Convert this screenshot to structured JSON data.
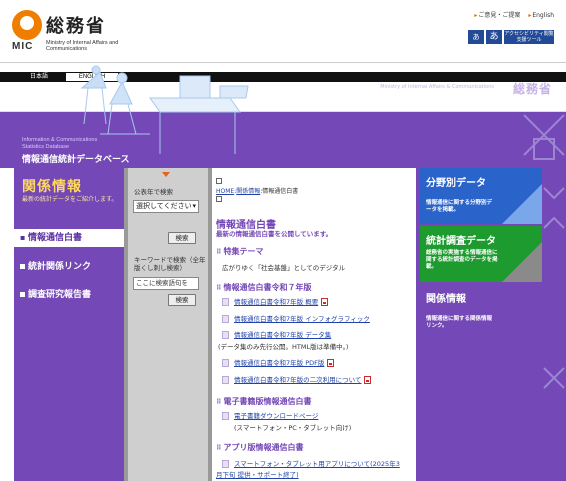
{
  "header": {
    "logo_ja": "総務省",
    "logo_mic": "MIC",
    "logo_en": "Ministry of Internal Affairs and Communications",
    "links": [
      "ご意見・ご提案",
      "English"
    ],
    "accessibility": {
      "font_small": "あ",
      "font_large": "あ",
      "tool_label": "アクセシビリティ閲覧支援ツール"
    }
  },
  "languages": [
    "日本語",
    "ENGLISH"
  ],
  "banner": {
    "en": "Ministry of Internal Affairs & Communications",
    "ja": "総務省",
    "db_en": "Information & Communications Statistics Database",
    "db_ja": "情報通信統計データベース"
  },
  "left": {
    "title": "関係情報",
    "subtitle": "最新の統計データをご紹介します。",
    "nav": [
      "情報通信白書",
      "統計関係リンク",
      "調査研究報告書"
    ]
  },
  "search": {
    "year_label": "公表年で検索",
    "year_select": "選択してください",
    "year_button": "検索",
    "kw_label": "キーワードで検索（全年版くし刺し検索）",
    "kw_placeholder": "ここに検索語句を",
    "kw_button": "検索"
  },
  "main": {
    "breadcrumb": [
      "HOME",
      "関係情報",
      "情報通信白書"
    ],
    "title": "情報通信白書",
    "subtitle": "最新の情報通信白書を公開しています。",
    "sec_theme": "特集テーマ",
    "theme_text": "広がりゆく「社会基盤」としてのデジタル",
    "sec_r7": "情報通信白書令和７年版",
    "items": [
      "情報通信白書令和7年版 概要",
      "情報通信白書令和7年版 インフォグラフィック",
      "情報通信白書令和7年版 データ集",
      "情報通信白書令和7年版 PDF版",
      "情報通信白書令和7年版の二次利用について"
    ],
    "data_note": "(データ集のみ先行公開。HTML版は準備中。)",
    "sec_ebook": "電子書籍版情報通信白書",
    "ebook_link": "電子書籍ダウンロードページ",
    "ebook_note": "(スマートフォン・PC・タブレット向け)",
    "sec_app": "アプリ版情報通信白書",
    "app_link": "スマートフォン・タブレット用アプリについて(2025年3",
    "app_link2": "月下旬 提供・サポート終了)"
  },
  "right": [
    {
      "title": "分野別データ",
      "desc": "情報通信に関する分野別データを掲載。"
    },
    {
      "title": "統計調査データ",
      "desc": "総務省の実施する情報通信に関する統計調査のデータを掲載。"
    },
    {
      "title": "関係情報",
      "desc": "情報通信に関する関係情報リンク。"
    }
  ],
  "colors": {
    "purple": "#7448b6",
    "blue_box": "#2a63c9",
    "green_box": "#1d9b2e",
    "accent_orange": "#e2641a"
  }
}
